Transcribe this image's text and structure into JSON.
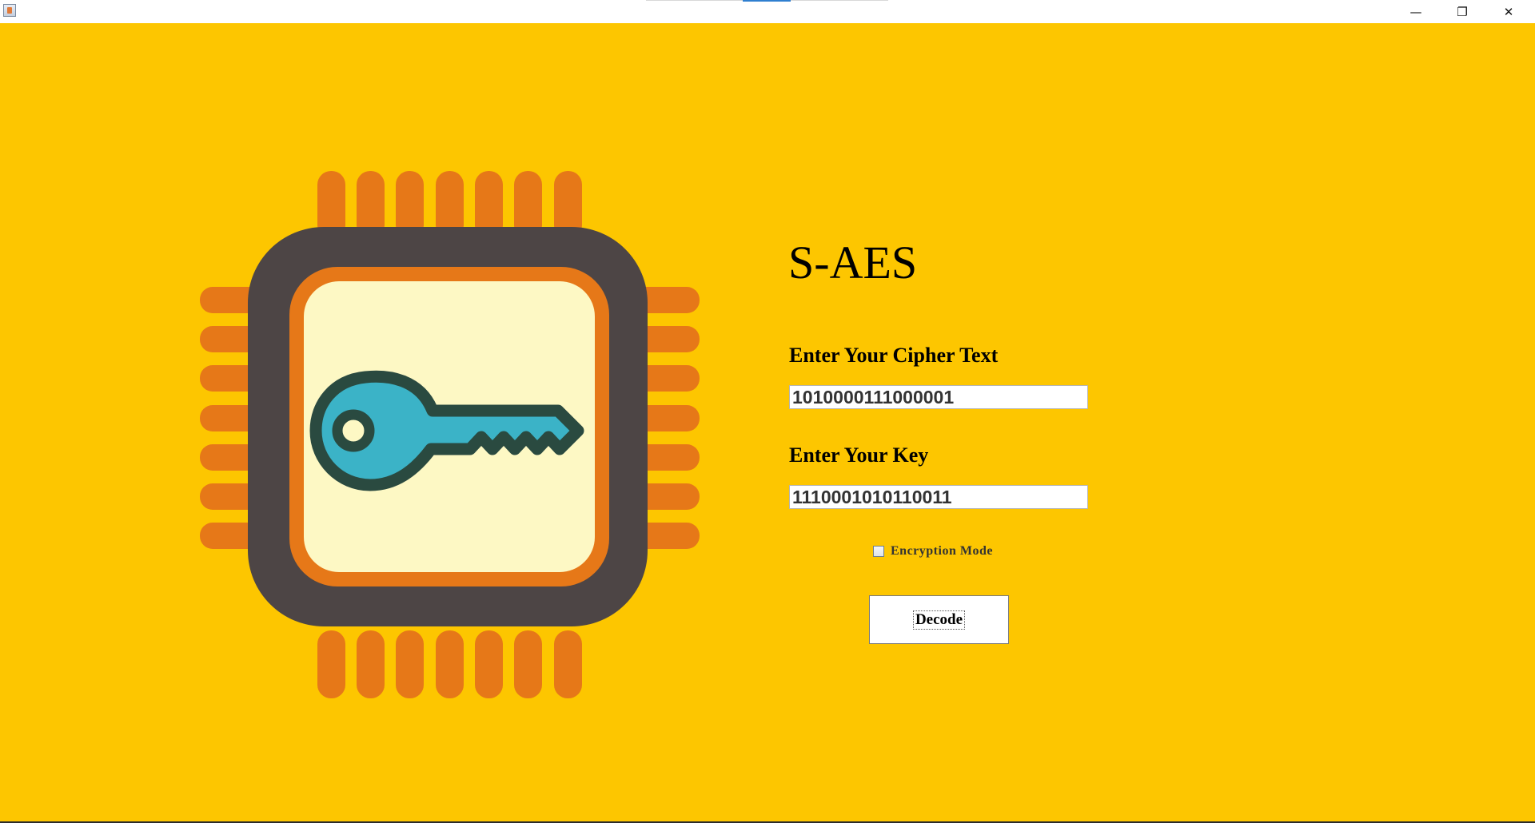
{
  "window": {
    "controls": {
      "minimize_icon": "minimize-icon",
      "restore_icon": "restore-icon",
      "close_icon": "close-icon",
      "minimize_glyph": "—",
      "restore_glyph": "❐",
      "close_glyph": "✕"
    }
  },
  "colors": {
    "background": "#fdc600",
    "chip_body": "#4d4545",
    "chip_pins": "#e67818",
    "chip_screen": "#fdf8c4",
    "key_fill": "#3bb3c7",
    "key_outline": "#2a4a40"
  },
  "illustration": {
    "icon": "chip-key-icon"
  },
  "form": {
    "title": "S-AES",
    "cipher_label": "Enter Your Cipher Text",
    "cipher_value": "1010000111000001",
    "key_label": "Enter Your Key",
    "key_value": "1110001010110011",
    "mode_label": "Encryption Mode",
    "mode_checked": false,
    "decode_label": "Decode"
  }
}
